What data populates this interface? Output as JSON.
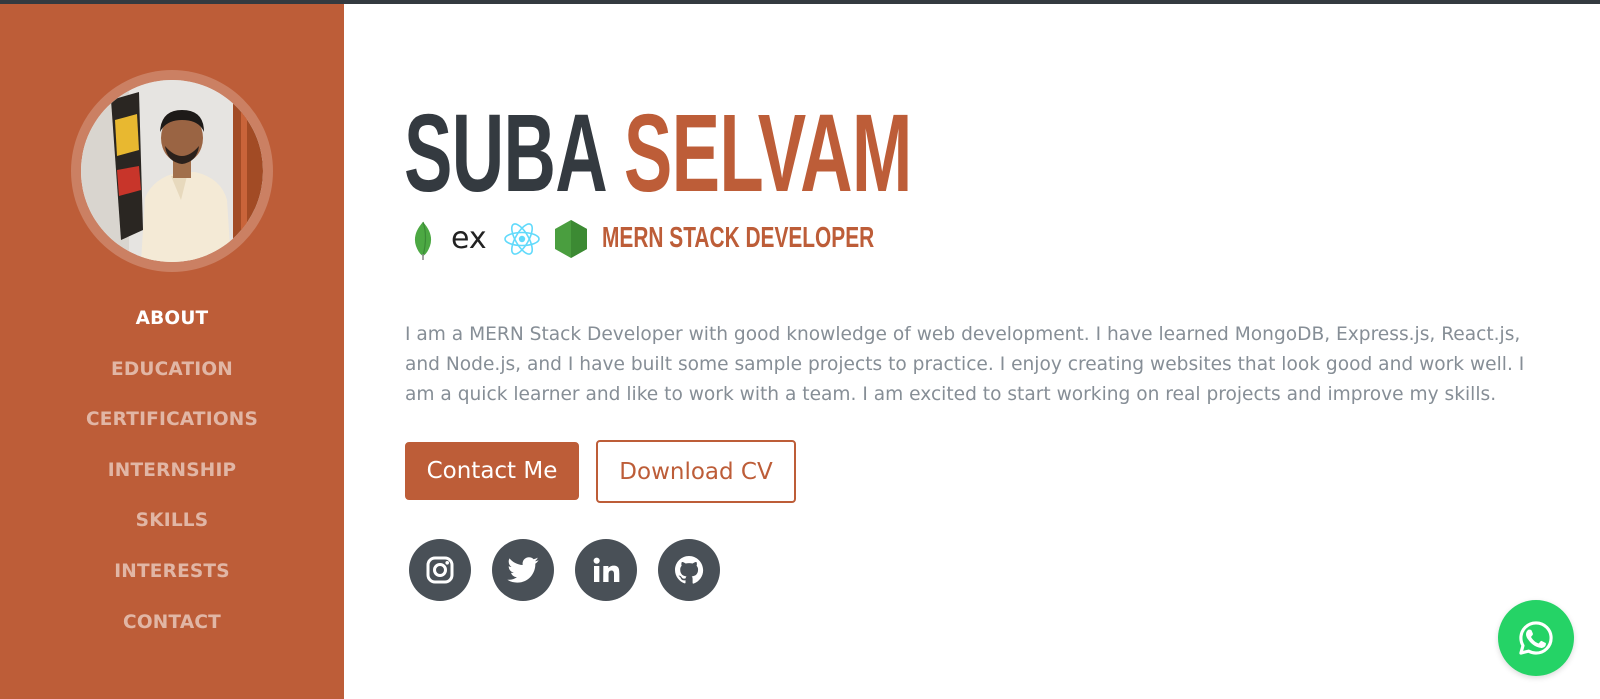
{
  "profile": {
    "first_name": "SUBA",
    "last_name": "SELVAM",
    "role": "MERN STACK DEVELOPER",
    "tech_icons": [
      "mongodb-icon",
      "express-icon",
      "react-icon",
      "nodejs-icon"
    ],
    "express_label": "ex",
    "bio": "I am a MERN Stack Developer with good knowledge of web development. I have learned MongoDB, Express.js, React.js, and Node.js, and I have built some sample projects to practice. I enjoy creating websites that look good and work well. I am a quick learner and like to work with a team. I am excited to start working on real projects and improve my skills."
  },
  "nav": {
    "items": [
      {
        "label": "ABOUT",
        "active": true
      },
      {
        "label": "EDUCATION",
        "active": false
      },
      {
        "label": "CERTIFICATIONS",
        "active": false
      },
      {
        "label": "INTERNSHIP",
        "active": false
      },
      {
        "label": "SKILLS",
        "active": false
      },
      {
        "label": "INTERESTS",
        "active": false
      },
      {
        "label": "CONTACT",
        "active": false
      }
    ]
  },
  "buttons": {
    "contact_label": "Contact Me",
    "cv_label": "Download CV"
  },
  "socials": [
    "instagram-icon",
    "twitter-icon",
    "linkedin-icon",
    "github-icon"
  ],
  "floating": {
    "icon": "whatsapp-icon"
  },
  "colors": {
    "accent": "#bd5d38",
    "dark": "#343a40",
    "muted_text": "#868e96",
    "social_bg": "#495057",
    "whatsapp": "#25d366"
  }
}
